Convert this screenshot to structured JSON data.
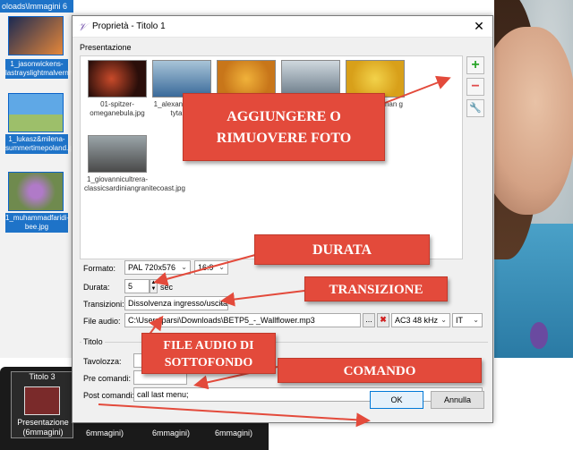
{
  "background": {
    "path_text": "oloads\\Immagini 6",
    "thumbs": [
      {
        "label": "1_jasonwickens-lastrayslightmalvernhills.jpg",
        "color1": "#1c2a52",
        "color2": "#e6873a"
      },
      {
        "label": "1_lukasz&milena-summertimepoland.jpg",
        "color1": "#5fa8e6",
        "color2": "#9dbf6a"
      },
      {
        "label": "1_muhammadfaridi-bee.jpg",
        "color1": "#6f8a4e",
        "color2": "#b07ac8"
      }
    ],
    "tiles": [
      {
        "title": "Titolo 3",
        "label": "Presentazione (6mmagini)"
      },
      {
        "title": "",
        "label": "6mmagini)"
      },
      {
        "title": "",
        "label": "6mmagini)"
      },
      {
        "title": "",
        "label": "6mmagini)"
      }
    ]
  },
  "dialog": {
    "title": "Proprietà - Titolo 1",
    "close_icon": "✕",
    "presentation_group": "Presentazione",
    "images": [
      {
        "caption": "01-spitzer-omeganebula.jpg",
        "c1": "#2a0e0a",
        "c2": "#c84a2a"
      },
      {
        "caption": "1_alexan tic-pingt tytaiwa",
        "c1": "#3a6a9a",
        "c2": "#a8c4d8"
      },
      {
        "caption": "",
        "c1": "#c8761a",
        "c2": "#f0b23a"
      },
      {
        "caption": "",
        "c1": "#6a7a88",
        "c2": "#cfd8de"
      },
      {
        "caption": "nnan g",
        "c1": "#d8a01a",
        "c2": "#f2d24a"
      },
      {
        "caption": "1_giovannicultrera-classicsardiniangranitecoast.jpg",
        "c1": "#4a4a4a",
        "c2": "#9aa4a8"
      }
    ],
    "add_icon": "+",
    "remove_icon": "−",
    "settings_icon": "🔧",
    "formato_label": "Formato:",
    "formato_value": "PAL 720x576",
    "aspect_value": "16:9",
    "durata_label": "Durata:",
    "durata_value": "5",
    "durata_unit": "sec",
    "transizioni_label": "Transizioni:",
    "transizioni_value": "Dissolvenza ingresso/uscita",
    "audio_label": "File audio:",
    "audio_value": "C:\\Users\\parsi\\Downloads\\BETP5_-_Wallflower.mp3",
    "browse_label": "...",
    "clear_icon": "✖",
    "audio_format": "AC3 48 kHz",
    "language": "IT",
    "titolo_group": "Titolo",
    "tavolozza_label": "Tavolozza:",
    "pre_label": "Pre comandi:",
    "post_label": "Post comandi:",
    "post_value": "call last menu;",
    "ok_label": "OK",
    "cancel_label": "Annulla"
  },
  "callouts": {
    "add_remove": "AGGIUNGERE  O RIMUOVERE FOTO",
    "durata": "DURATA",
    "transizione": "TRANSIZIONE",
    "audio": "FILE AUDIO DI SOTTOFONDO",
    "comando": "COMANDO"
  },
  "colors": {
    "callout": "#e34a3b",
    "accent": "#1e73c8"
  }
}
